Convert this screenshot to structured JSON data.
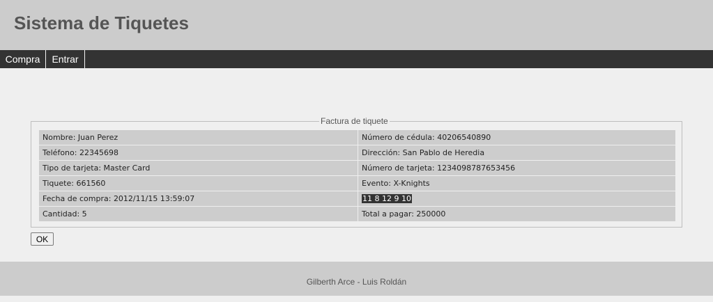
{
  "header": {
    "title": "Sistema de Tiquetes"
  },
  "nav": {
    "items": [
      {
        "label": "Compra"
      },
      {
        "label": "Entrar"
      }
    ]
  },
  "invoice": {
    "legend": "Factura de tiquete",
    "rows": [
      {
        "left": "Nombre: Juan Perez",
        "right": "Número de cédula: 40206540890"
      },
      {
        "left": "Teléfono: 22345698",
        "right": "Dirección: San Pablo de Heredia"
      },
      {
        "left": "Tipo de tarjeta: Master Card",
        "right": "Número de tarjeta: 1234098787653456"
      },
      {
        "left": "Tiquete: 661560",
        "right": "Evento: X-Knights"
      },
      {
        "left": "Fecha de compra: 2012/11/15 13:59:07",
        "right": "11 8 12 9 10"
      },
      {
        "left": "Cantidad: 5",
        "right": "Total a pagar: 250000"
      }
    ]
  },
  "actions": {
    "ok_label": "OK"
  },
  "footer": {
    "text": "Gilberth Arce - Luis Roldán"
  }
}
